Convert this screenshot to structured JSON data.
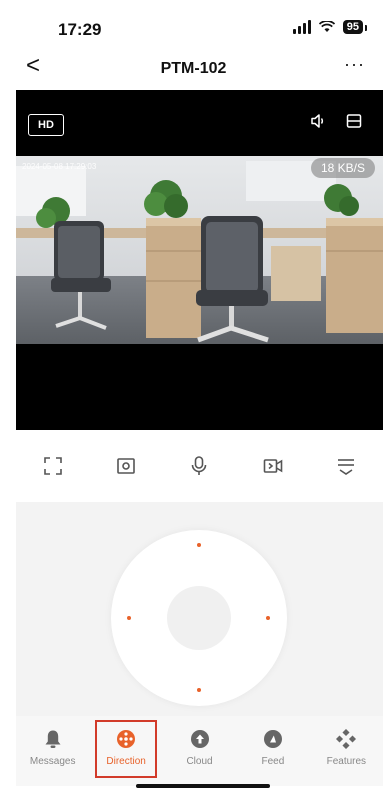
{
  "status": {
    "time": "17:29",
    "battery": "95"
  },
  "nav": {
    "back": "<",
    "title": "PTM-102",
    "more": "···"
  },
  "video": {
    "quality_label": "HD",
    "osd_timestamp": "2024-05-08 17:29:03",
    "speed": "18 KB/S"
  },
  "controls": [
    {
      "name": "fullscreen-icon"
    },
    {
      "name": "screenshot-icon"
    },
    {
      "name": "microphone-icon"
    },
    {
      "name": "record-icon"
    },
    {
      "name": "more-controls-icon"
    }
  ],
  "tabs": [
    {
      "label": "Messages",
      "icon": "bell-icon",
      "active": false
    },
    {
      "label": "Direction",
      "icon": "direction-icon",
      "active": true
    },
    {
      "label": "Cloud",
      "icon": "cloud-icon",
      "active": false
    },
    {
      "label": "Feed",
      "icon": "feed-icon",
      "active": false
    },
    {
      "label": "Features",
      "icon": "features-icon",
      "active": false
    }
  ],
  "colors": {
    "accent": "#e8622a",
    "highlight": "#d23b2a"
  }
}
